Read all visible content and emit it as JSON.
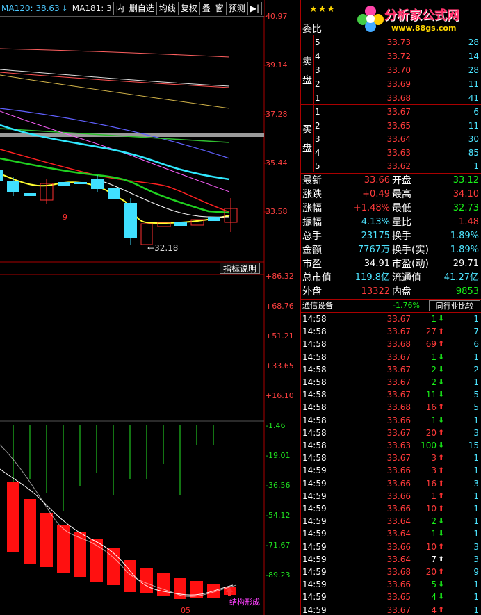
{
  "toolbar": {
    "ma120": "MA120: 38.63",
    "ma120_arrow": "↓",
    "ma181": "MA181: 3",
    "buttons": [
      "内",
      "删自选",
      "均线",
      "复权",
      "叠",
      "窗",
      "预测"
    ],
    "nav": "▶|",
    "menu_arrow": "▼"
  },
  "price_axis": [
    "40.97",
    "39.14",
    "37.28",
    "35.44",
    "33.58"
  ],
  "indicator_axis": [
    "+86.32",
    "+68.76",
    "+51.21",
    "+33.65",
    "+16.10",
    "-1.46",
    "-19.01",
    "-36.56",
    "-54.12",
    "-71.67",
    "-89.23"
  ],
  "chart": {
    "low_label": "32.18",
    "marker_9": "9",
    "indicator_button": "指标说明",
    "signal_label": "结构形成",
    "date_label": "05"
  },
  "brand": {
    "stars": "★★★",
    "logo_text": "分析家公式网",
    "logo_url_text": "www.88gs.com"
  },
  "orderbook": {
    "ratio_label": "委比",
    "sell_label": [
      "卖",
      "盘"
    ],
    "buy_label": [
      "买",
      "盘"
    ],
    "sell": [
      {
        "lvl": "5",
        "price": "33.73",
        "vol": "28"
      },
      {
        "lvl": "4",
        "price": "33.72",
        "vol": "14"
      },
      {
        "lvl": "3",
        "price": "33.70",
        "vol": "28"
      },
      {
        "lvl": "2",
        "price": "33.69",
        "vol": "11"
      },
      {
        "lvl": "1",
        "price": "33.68",
        "vol": "41"
      }
    ],
    "buy": [
      {
        "lvl": "1",
        "price": "33.67",
        "vol": "6"
      },
      {
        "lvl": "2",
        "price": "33.65",
        "vol": "11"
      },
      {
        "lvl": "3",
        "price": "33.64",
        "vol": "30"
      },
      {
        "lvl": "4",
        "price": "33.63",
        "vol": "85"
      },
      {
        "lvl": "5",
        "price": "33.62",
        "vol": "1"
      }
    ]
  },
  "quote": [
    {
      "l1": "最新",
      "v1": "33.66",
      "c1": "c-num",
      "l2": "开盘",
      "v2": "33.12",
      "c2": "c-grn"
    },
    {
      "l1": "涨跌",
      "v1": "+0.49",
      "c1": "c-num",
      "l2": "最高",
      "v2": "34.10",
      "c2": "c-num"
    },
    {
      "l1": "涨幅",
      "v1": "+1.48%",
      "c1": "c-num",
      "l2": "最低",
      "v2": "32.73",
      "c2": "c-grn"
    },
    {
      "l1": "振幅",
      "v1": "4.13%",
      "c1": "c-cyan",
      "l2": "量比",
      "v2": "1.48",
      "c2": "c-num"
    },
    {
      "l1": "总手",
      "v1": "23175",
      "c1": "c-cyan",
      "l2": "换手",
      "v2": "1.89%",
      "c2": "c-cyan"
    },
    {
      "l1": "金额",
      "v1": "7767万",
      "c1": "c-cyan",
      "l2": "换手(实)",
      "v2": "1.89%",
      "c2": "c-cyan"
    },
    {
      "l1": "市盈",
      "v1": "34.91",
      "c1": "c-white",
      "l2": "市盈(动)",
      "v2": "29.71",
      "c2": "c-white"
    },
    {
      "l1": "总市值",
      "v1": "119.8亿",
      "c1": "c-cyan",
      "l2": "流通值",
      "v2": "41.27亿",
      "c2": "c-cyan"
    },
    {
      "l1": "外盘",
      "v1": "13322",
      "c1": "c-num",
      "l2": "内盘",
      "v2": "9853",
      "c2": "c-grn"
    }
  ],
  "industry": {
    "name": "通信设备",
    "change": "-1.76%",
    "compare_btn": "同行业比较"
  },
  "ticks": [
    {
      "t": "14:58",
      "p": "33.67",
      "pc": "c-num",
      "v": "1",
      "d": "dn",
      "n": "1"
    },
    {
      "t": "14:58",
      "p": "33.67",
      "pc": "c-num",
      "v": "27",
      "d": "up",
      "n": "7"
    },
    {
      "t": "14:58",
      "p": "33.68",
      "pc": "c-num",
      "v": "69",
      "d": "up",
      "n": "6"
    },
    {
      "t": "14:58",
      "p": "33.67",
      "pc": "c-num",
      "v": "1",
      "d": "dn",
      "n": "1"
    },
    {
      "t": "14:58",
      "p": "33.67",
      "pc": "c-num",
      "v": "2",
      "d": "dn",
      "n": "2"
    },
    {
      "t": "14:58",
      "p": "33.67",
      "pc": "c-num",
      "v": "2",
      "d": "dn",
      "n": "1"
    },
    {
      "t": "14:58",
      "p": "33.67",
      "pc": "c-num",
      "v": "11",
      "d": "dn",
      "n": "5"
    },
    {
      "t": "14:58",
      "p": "33.68",
      "pc": "c-num",
      "v": "16",
      "d": "up",
      "n": "5"
    },
    {
      "t": "14:58",
      "p": "33.66",
      "pc": "c-num",
      "v": "1",
      "d": "dn",
      "n": "1"
    },
    {
      "t": "14:58",
      "p": "33.67",
      "pc": "c-num",
      "v": "20",
      "d": "up",
      "n": "3"
    },
    {
      "t": "14:58",
      "p": "33.63",
      "pc": "c-num",
      "v": "100",
      "d": "dn",
      "n": "15"
    },
    {
      "t": "14:58",
      "p": "33.67",
      "pc": "c-num",
      "v": "3",
      "d": "up",
      "n": "1"
    },
    {
      "t": "14:59",
      "p": "33.66",
      "pc": "c-num",
      "v": "3",
      "d": "up",
      "n": "1"
    },
    {
      "t": "14:59",
      "p": "33.66",
      "pc": "c-num",
      "v": "16",
      "d": "up",
      "n": "3"
    },
    {
      "t": "14:59",
      "p": "33.66",
      "pc": "c-num",
      "v": "1",
      "d": "up",
      "n": "1"
    },
    {
      "t": "14:59",
      "p": "33.66",
      "pc": "c-num",
      "v": "10",
      "d": "up",
      "n": "1"
    },
    {
      "t": "14:59",
      "p": "33.64",
      "pc": "c-num",
      "v": "2",
      "d": "dn",
      "n": "1"
    },
    {
      "t": "14:59",
      "p": "33.64",
      "pc": "c-num",
      "v": "1",
      "d": "dn",
      "n": "1"
    },
    {
      "t": "14:59",
      "p": "33.66",
      "pc": "c-num",
      "v": "10",
      "d": "up",
      "n": "3"
    },
    {
      "t": "14:59",
      "p": "33.64",
      "pc": "c-num",
      "v": "7",
      "d": "wt",
      "n": "3"
    },
    {
      "t": "14:59",
      "p": "33.68",
      "pc": "c-num",
      "v": "20",
      "d": "up",
      "n": "9"
    },
    {
      "t": "14:59",
      "p": "33.66",
      "pc": "c-num",
      "v": "5",
      "d": "dn",
      "n": "1"
    },
    {
      "t": "14:59",
      "p": "33.65",
      "pc": "c-num",
      "v": "4",
      "d": "dn",
      "n": "1"
    },
    {
      "t": "14:59",
      "p": "33.67",
      "pc": "c-num",
      "v": "4",
      "d": "up",
      "n": "1"
    }
  ]
}
